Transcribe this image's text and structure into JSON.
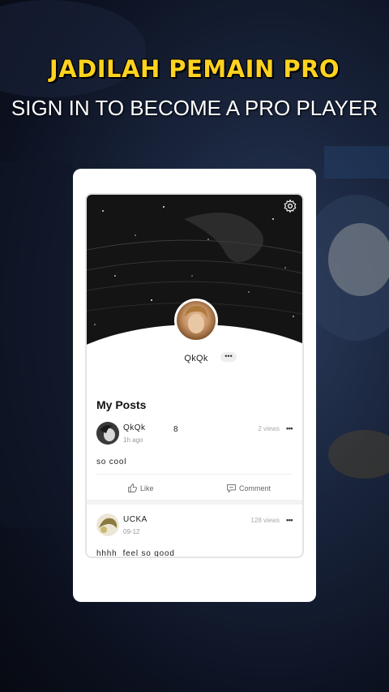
{
  "banner": {
    "headline": "JADILAH PEMAIN PRO",
    "subheadline": "SIGN IN TO BECOME A PRO PLAYER",
    "headline_color": "#ffd21f"
  },
  "profile": {
    "settings_icon": "gear-icon",
    "username": "QkQk",
    "more_label": "•••"
  },
  "section_title": "My Posts",
  "posts": [
    {
      "author": "QkQk",
      "time": "1h ago",
      "count": "8",
      "views": "2 views",
      "menu": "•••",
      "text": "so cool",
      "like_label": "Like",
      "comment_label": "Comment"
    },
    {
      "author": "UCKA",
      "time": "09-12",
      "views": "128 views",
      "menu": "•••",
      "text": "hhhh  feel so good"
    }
  ]
}
